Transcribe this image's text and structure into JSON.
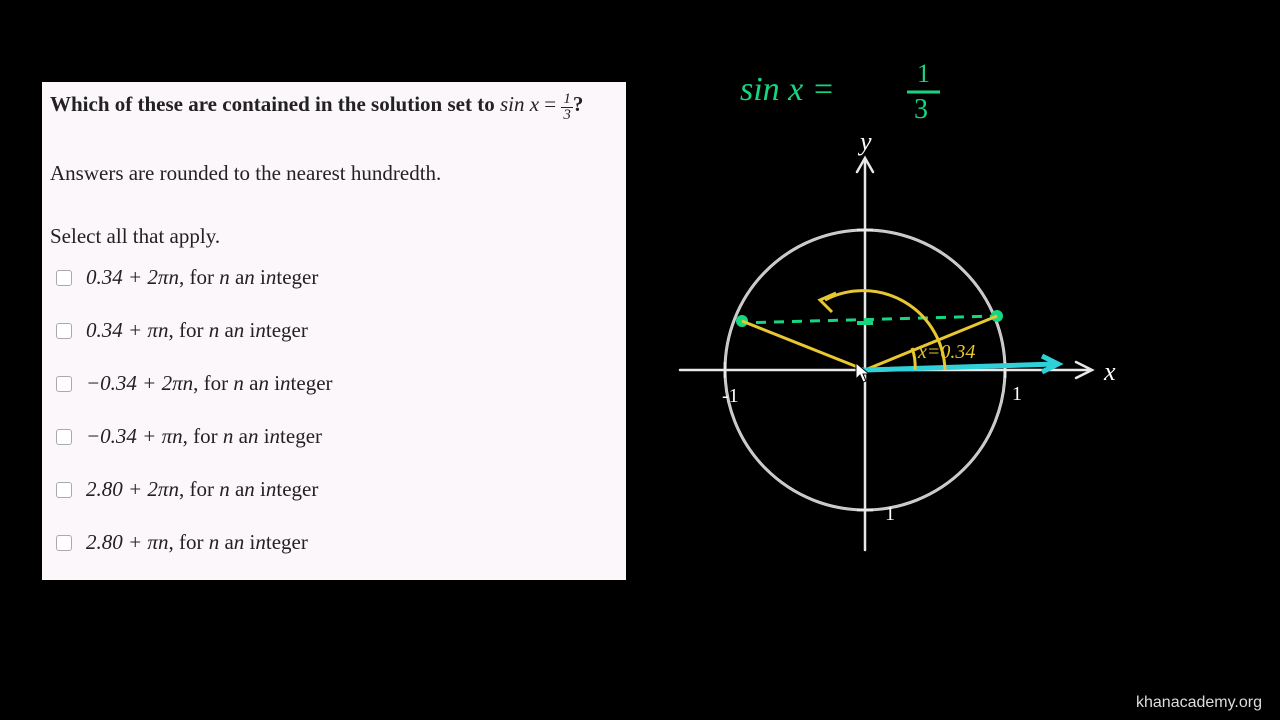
{
  "question": {
    "prompt_prefix": "Which of these are contained in the solution set to ",
    "equation_lhs": "sin",
    "equation_var": "x",
    "equation_eq": " = ",
    "frac_num": "1",
    "frac_den": "3",
    "prompt_suffix": "?",
    "sub": "Answers are rounded to the nearest hundredth.",
    "select": "Select all that apply."
  },
  "answers": [
    {
      "value": "0.34 + 2πn",
      "tail": ", for n an integer"
    },
    {
      "value": "0.34 + πn",
      "tail": ", for n an integer"
    },
    {
      "value": "−0.34 + 2πn",
      "tail": ", for n an integer"
    },
    {
      "value": "−0.34 + πn",
      "tail": ", for n an integer"
    },
    {
      "value": "2.80 + 2πn",
      "tail": ", for n an integer"
    },
    {
      "value": "2.80 + πn",
      "tail": ", for n an integer"
    }
  ],
  "board": {
    "equation": "sin x = 1/3",
    "y_label": "y",
    "x_label": "x",
    "angle_label": "x=0.34",
    "neg_one": "-1",
    "pos_one": "1"
  },
  "watermark": "khanacademy.org",
  "chart_data": {
    "type": "diagram",
    "description": "Unit circle with horizontal chord at y = 1/3; two intersection points marked in green; reference angle x ≈ 0.34 shown in quadrant I; supplementary angle arc drawn toward quadrant II.",
    "sin_value": 0.3333,
    "principal_angle_rad": 0.34,
    "supplementary_angle_rad": 2.8,
    "axis_labels": {
      "x": "x",
      "y": "y"
    },
    "ticks": {
      "x": [
        -1,
        1
      ],
      "y": [
        -1,
        1
      ]
    }
  }
}
